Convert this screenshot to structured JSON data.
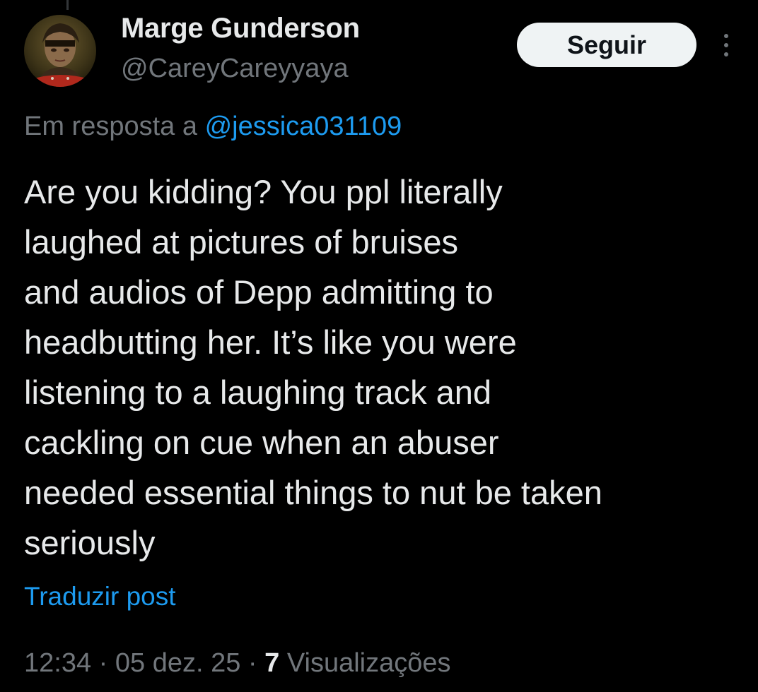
{
  "author": {
    "display_name": "Marge Gunderson",
    "handle": "@CareyCareyyaya",
    "avatar": "profile-photo"
  },
  "actions": {
    "follow_label": "Seguir",
    "more_icon": "more-vertical-icon"
  },
  "reply": {
    "prefix": "Em resposta a",
    "mention": "@jessica031109"
  },
  "tweet": {
    "text": "Are you kidding? You ppl literally\nlaughed at pictures of bruises\nand audios of Depp admitting to\nheadbutting her. It’s like you were\nlistening to a laughing track and\ncackling on cue when an abuser\nneeded essential things to nut be taken\nseriously"
  },
  "translate_label": "Traduzir post",
  "meta": {
    "time": "12:34",
    "date": "05 dez. 25",
    "views_count": "7",
    "views_label": "Visualizações",
    "separator": " · "
  },
  "colors": {
    "background": "#000000",
    "primary_text": "#e7e9ea",
    "secondary_text": "#71767b",
    "link": "#1d9bf0",
    "button_bg": "#eff3f4"
  }
}
